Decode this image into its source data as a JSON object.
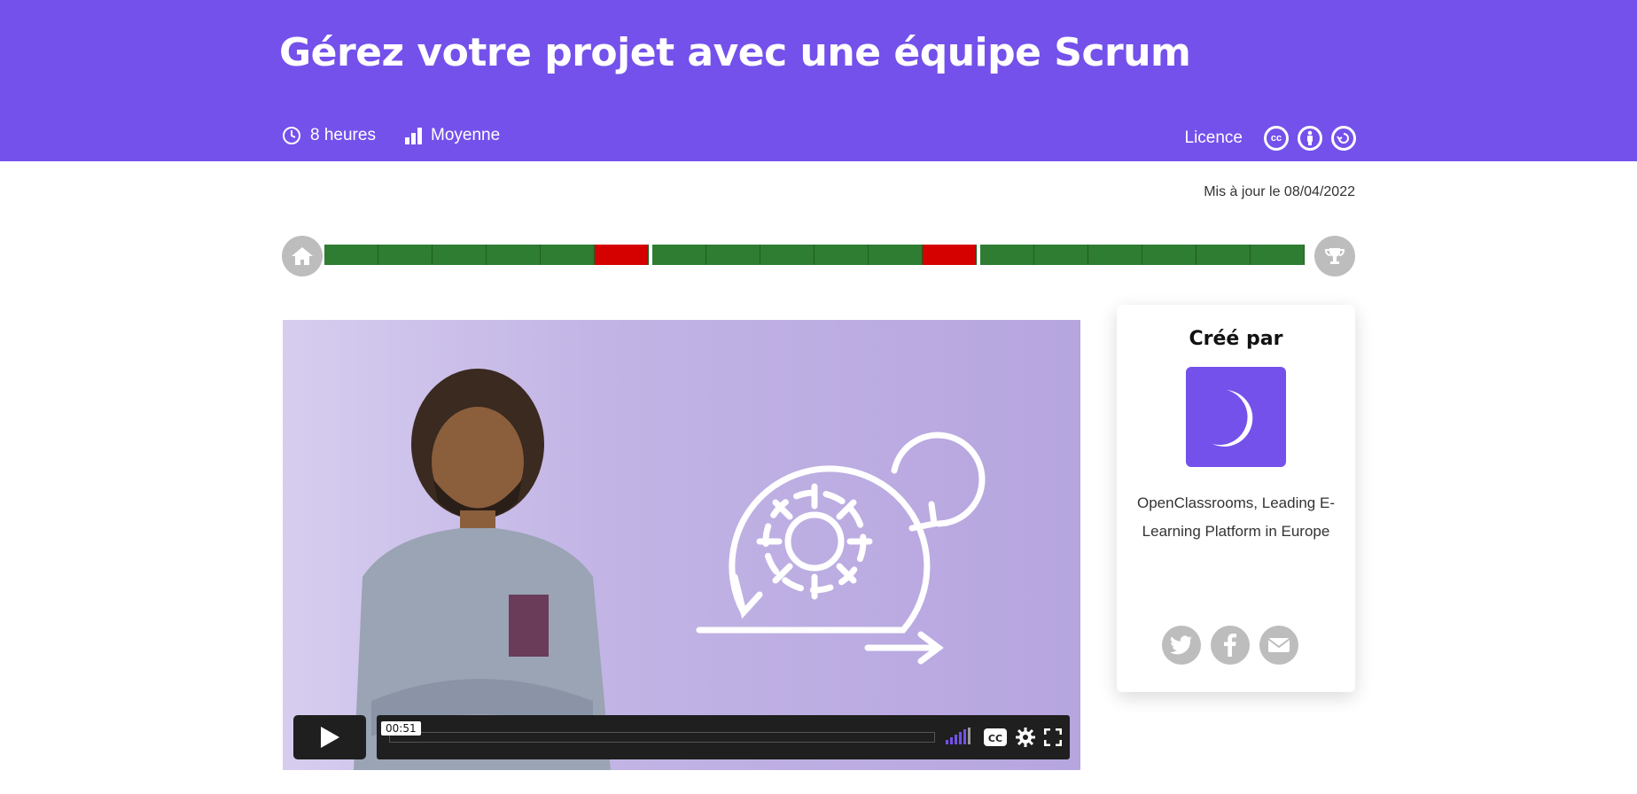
{
  "course": {
    "title": "Gérez votre projet avec une équipe Scrum",
    "duration": "8 heures",
    "level": "Moyenne",
    "licence_label": "Licence",
    "licence_icons": [
      "cc-icon",
      "by-icon",
      "sa-icon"
    ],
    "updated": "Mis à jour le 08/04/2022"
  },
  "progress": {
    "groups": [
      [
        "green",
        "green",
        "green",
        "green",
        "green",
        "red"
      ],
      [
        "green",
        "green",
        "green",
        "green",
        "green",
        "red"
      ],
      [
        "green",
        "green",
        "green",
        "green",
        "green",
        "green"
      ]
    ],
    "colors": {
      "green": "#2e7d32",
      "red": "#d50000"
    }
  },
  "video": {
    "current_time": "00:51",
    "progress": 0.0
  },
  "author_card": {
    "heading": "Créé par",
    "author_name": "OpenClassrooms, Leading E-Learning Platform in Europe",
    "socials": [
      "twitter-icon",
      "facebook-icon",
      "mail-icon"
    ]
  },
  "theme": {
    "accent": "#7451eb"
  }
}
